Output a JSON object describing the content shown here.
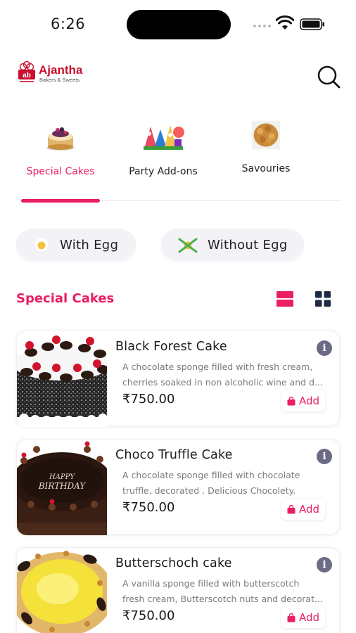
{
  "status": {
    "time": "6:26"
  },
  "brand": {
    "name": "Ajantha",
    "subtitle": "Bakers & Sweets",
    "monogram": "ab",
    "accent": "#e91e63",
    "logo_red": "#c8102e"
  },
  "header": {
    "search_icon": "search-icon"
  },
  "categories": [
    {
      "label": "Special Cakes",
      "active": true
    },
    {
      "label": "Party Add-ons",
      "active": false
    },
    {
      "label": "Savouries",
      "active": false
    }
  ],
  "filters": {
    "with_egg": "With Egg",
    "without_egg": "Without Egg"
  },
  "section": {
    "title": "Special Cakes",
    "view_modes": [
      "list-view-icon",
      "grid-view-icon"
    ],
    "active_view": "list"
  },
  "products": [
    {
      "name": "Black Forest Cake",
      "desc_line1": "A chocolate sponge filled with fresh cream,",
      "desc_line2": "cherries soaked in non alcoholic wine and d...",
      "price": "₹750.00",
      "add_label": "Add",
      "info": "i"
    },
    {
      "name": "Choco Truffle Cake",
      "desc_line1": "A chocolate sponge filled with chocolate",
      "desc_line2": "truffle, decorated . Delicious Chocolety.",
      "price": "₹750.00",
      "add_label": "Add",
      "info": "i",
      "cake_text_1": "HAPPY",
      "cake_text_2": "BIRTHDAY"
    },
    {
      "name": "Butterschoch cake",
      "desc_line1": "A vanilla  sponge filled with butterscotch",
      "desc_line2": "fresh cream, Butterscotch nuts and decorat...",
      "price": "₹750.00",
      "add_label": "Add",
      "info": "i"
    }
  ]
}
